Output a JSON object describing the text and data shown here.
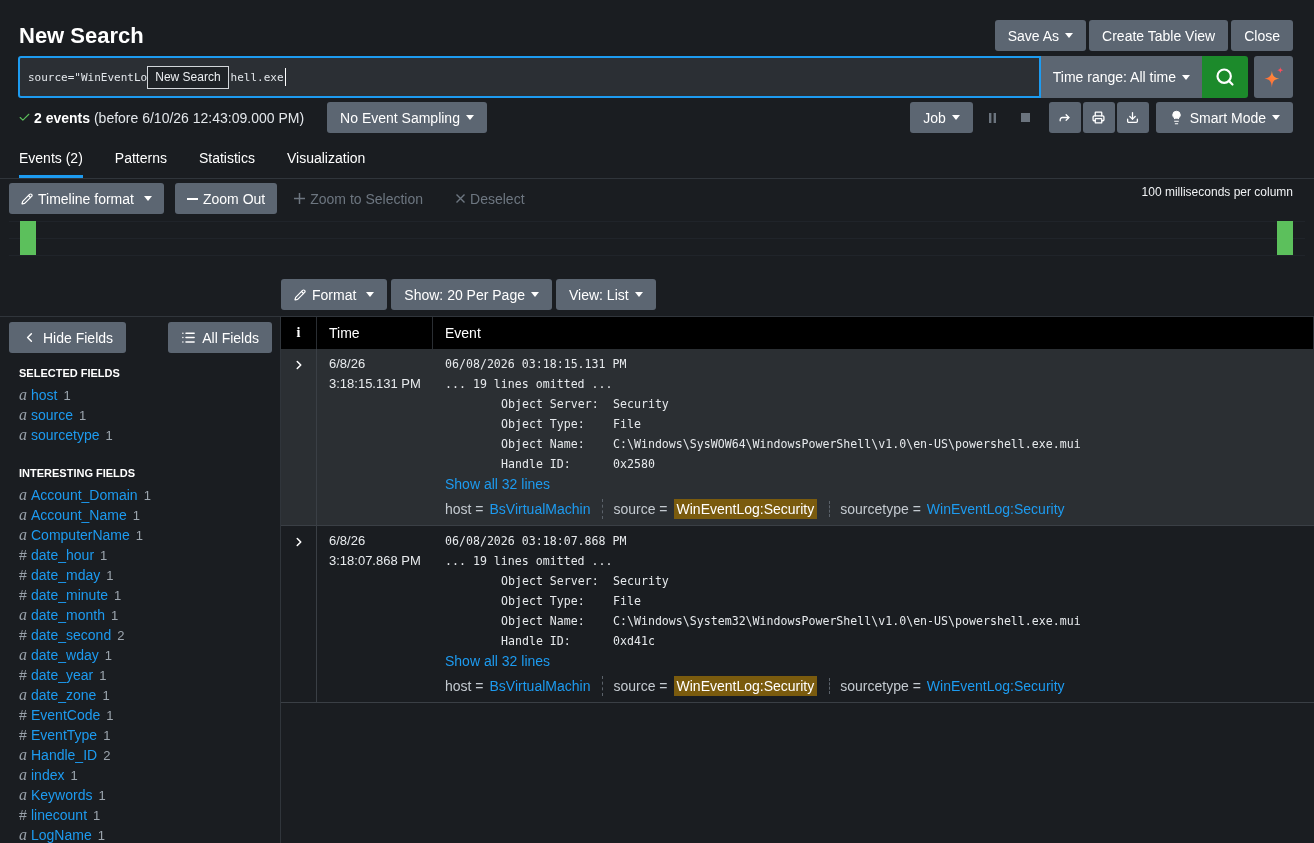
{
  "header": {
    "title": "New Search",
    "actions": [
      {
        "label": "Save As",
        "dropdown": true
      },
      {
        "label": "Create Table View",
        "dropdown": false
      },
      {
        "label": "Close",
        "dropdown": false
      }
    ]
  },
  "search": {
    "query_parts": [
      "source=\"WinEventLo",
      "hell.exe"
    ],
    "tooltip": "New Search",
    "time_range": {
      "label": "Time range: All time",
      "dropdown": true
    }
  },
  "status": {
    "summary": "**2 events** (before 6/10/26 12:43:09.000 PM)",
    "sampling": {
      "label": "No Event Sampling",
      "dropdown": true
    },
    "job": {
      "label": "Job",
      "dropdown": true
    },
    "job_controls": [
      {
        "kind": "pause",
        "disabled": true
      },
      {
        "kind": "stop",
        "disabled": true
      }
    ],
    "tools": [
      {
        "kind": "share"
      },
      {
        "kind": "print"
      },
      {
        "kind": "export"
      }
    ],
    "mode": {
      "label": "Smart Mode",
      "dropdown": true
    }
  },
  "tabs": [
    {
      "label": "Events (2)",
      "selected": true
    },
    {
      "label": "Patterns",
      "selected": false
    },
    {
      "label": "Statistics",
      "selected": false
    },
    {
      "label": "Visualization",
      "selected": false
    }
  ],
  "timeline": {
    "buttons": [
      {
        "kind": "format",
        "label": "Timeline format",
        "dropdown": true,
        "disabled": false
      },
      {
        "kind": "zoom_out",
        "label": "Zoom Out",
        "dropdown": false,
        "disabled": false
      },
      {
        "kind": "zoom_in",
        "label": "Zoom to Selection",
        "dropdown": false,
        "disabled": true
      },
      {
        "kind": "deselect",
        "label": "Deselect",
        "dropdown": false,
        "disabled": true
      }
    ],
    "scale": "100 milliseconds per column"
  },
  "results_toolbar": [
    {
      "kind": "format",
      "label": "Format",
      "dropdown": true
    },
    {
      "kind": "page_size",
      "label": "Show: 20 Per Page",
      "dropdown": true
    },
    {
      "kind": "view",
      "label": "View: List",
      "dropdown": true
    }
  ],
  "sidebar": {
    "buttons": [
      {
        "kind": "hide",
        "label": "Hide Fields"
      },
      {
        "kind": "all",
        "label": "All Fields"
      }
    ],
    "groups": [
      {
        "title": "SELECTED FIELDS",
        "fields": [
          {
            "kind": "string",
            "glyph": "a",
            "name": "host",
            "count": "1"
          },
          {
            "kind": "string",
            "glyph": "a",
            "name": "source",
            "count": "1"
          },
          {
            "kind": "string",
            "glyph": "a",
            "name": "sourcetype",
            "count": "1"
          }
        ]
      },
      {
        "title": "INTERESTING FIELDS",
        "fields": [
          {
            "kind": "string",
            "glyph": "a",
            "name": "Account_Domain",
            "count": "1"
          },
          {
            "kind": "string",
            "glyph": "a",
            "name": "Account_Name",
            "count": "1"
          },
          {
            "kind": "string",
            "glyph": "a",
            "name": "ComputerName",
            "count": "1"
          },
          {
            "kind": "number",
            "glyph": "#",
            "name": "date_hour",
            "count": "1"
          },
          {
            "kind": "number",
            "glyph": "#",
            "name": "date_mday",
            "count": "1"
          },
          {
            "kind": "number",
            "glyph": "#",
            "name": "date_minute",
            "count": "1"
          },
          {
            "kind": "string",
            "glyph": "a",
            "name": "date_month",
            "count": "1"
          },
          {
            "kind": "number",
            "glyph": "#",
            "name": "date_second",
            "count": "2"
          },
          {
            "kind": "string",
            "glyph": "a",
            "name": "date_wday",
            "count": "1"
          },
          {
            "kind": "number",
            "glyph": "#",
            "name": "date_year",
            "count": "1"
          },
          {
            "kind": "string",
            "glyph": "a",
            "name": "date_zone",
            "count": "1"
          },
          {
            "kind": "number",
            "glyph": "#",
            "name": "EventCode",
            "count": "1"
          },
          {
            "kind": "number",
            "glyph": "#",
            "name": "EventType",
            "count": "1"
          },
          {
            "kind": "string",
            "glyph": "a",
            "name": "Handle_ID",
            "count": "2"
          },
          {
            "kind": "string",
            "glyph": "a",
            "name": "index",
            "count": "1"
          },
          {
            "kind": "string",
            "glyph": "a",
            "name": "Keywords",
            "count": "1"
          },
          {
            "kind": "number",
            "glyph": "#",
            "name": "linecount",
            "count": "1"
          },
          {
            "kind": "string",
            "glyph": "a",
            "name": "LogName",
            "count": "1"
          }
        ]
      }
    ]
  },
  "table": {
    "columns": [
      "i",
      "Time",
      "Event"
    ],
    "events": [
      {
        "expanded": false,
        "highlighted": true,
        "date": "6/8/26",
        "time": "3:18:15.131 PM",
        "lines": [
          {
            "kind": "plain",
            "text": "06/08/2026 03:18:15.131 PM"
          },
          {
            "kind": "plain",
            "text": "... 19 lines omitted ..."
          },
          {
            "kind": "pair",
            "label": "Object Server:",
            "value": "Security"
          },
          {
            "kind": "pair",
            "label": "Object Type:",
            "value": "File"
          },
          {
            "kind": "pair",
            "label": "Object Name:",
            "value": "C:\\Windows\\SysWOW64\\WindowsPowerShell\\v1.0\\en-US\\powershell.exe.mui"
          },
          {
            "kind": "pair",
            "label": "Handle ID:",
            "value": "0x2580"
          }
        ],
        "show_all": "Show all 32 lines",
        "fields": [
          {
            "key": "host =",
            "value": "BsVirtualMachin",
            "matched": false
          },
          {
            "key": "source =",
            "value": "WinEventLog:Security",
            "matched": true
          },
          {
            "key": "sourcetype =",
            "value": "WinEventLog:Security",
            "matched": false
          }
        ]
      },
      {
        "expanded": false,
        "highlighted": false,
        "date": "6/8/26",
        "time": "3:18:07.868 PM",
        "lines": [
          {
            "kind": "plain",
            "text": "06/08/2026 03:18:07.868 PM"
          },
          {
            "kind": "plain",
            "text": "... 19 lines omitted ..."
          },
          {
            "kind": "pair",
            "label": "Object Server:",
            "value": "Security"
          },
          {
            "kind": "pair",
            "label": "Object Type:",
            "value": "File"
          },
          {
            "kind": "pair",
            "label": "Object Name:",
            "value": "C:\\Windows\\System32\\WindowsPowerShell\\v1.0\\en-US\\powershell.exe.mui"
          },
          {
            "kind": "pair",
            "label": "Handle ID:",
            "value": "0xd41c"
          }
        ],
        "show_all": "Show all 32 lines",
        "fields": [
          {
            "key": "host =",
            "value": "BsVirtualMachin",
            "matched": false
          },
          {
            "key": "source =",
            "value": "WinEventLog:Security",
            "matched": true
          },
          {
            "key": "sourcetype =",
            "value": "WinEventLog:Security",
            "matched": false
          }
        ]
      }
    ]
  }
}
